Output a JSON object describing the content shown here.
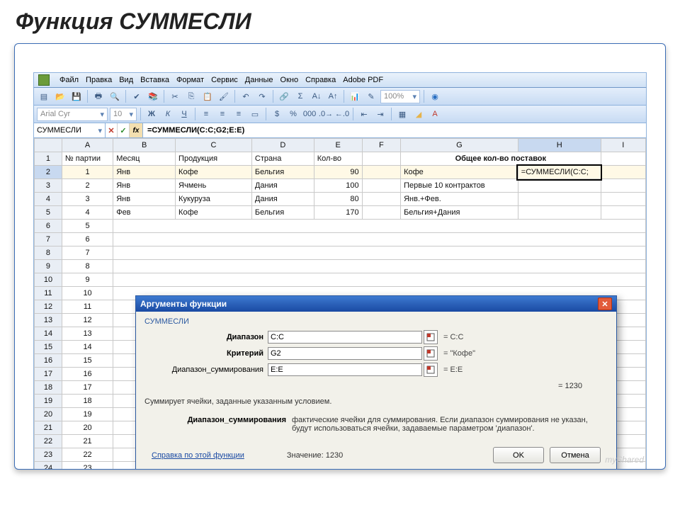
{
  "slide": {
    "title": "Функция СУММЕСЛИ"
  },
  "menu": {
    "file": "Файл",
    "edit": "Правка",
    "view": "Вид",
    "insert": "Вставка",
    "format": "Формат",
    "tools": "Сервис",
    "data": "Данные",
    "window": "Окно",
    "help": "Справка",
    "pdf": "Adobe PDF"
  },
  "toolbar": {
    "zoom": "100%"
  },
  "fontbar": {
    "font": "Arial Cyr",
    "size": "10",
    "bold": "Ж",
    "italic": "К",
    "underline": "Ч"
  },
  "editbar": {
    "name": "СУММЕСЛИ",
    "fx": "fx",
    "formula": "=СУММЕСЛИ(C:C;G2;E:E)"
  },
  "cols": [
    "",
    "A",
    "B",
    "C",
    "D",
    "E",
    "F",
    "G",
    "H",
    "I"
  ],
  "headers": {
    "a": "№ партии",
    "b": "Месяц",
    "c": "Продукция",
    "d": "Страна",
    "e": "Кол-во",
    "gh": "Общее кол-во поставок"
  },
  "rows": [
    {
      "n": "1"
    },
    {
      "n": "2",
      "a": "1",
      "b": "Янв",
      "c": "Кофе",
      "d": "Бельгия",
      "e": "90",
      "g": "Кофе",
      "h": "=СУММЕСЛИ(C:C;"
    },
    {
      "n": "3",
      "a": "2",
      "b": "Янв",
      "c": "Ячмень",
      "d": "Дания",
      "e": "100",
      "g": "Первые 10 контрактов"
    },
    {
      "n": "4",
      "a": "3",
      "b": "Янв",
      "c": "Кукуруза",
      "d": "Дания",
      "e": "80",
      "g": "Янв.+Фев."
    },
    {
      "n": "5",
      "a": "4",
      "b": "Фев",
      "c": "Кофе",
      "d": "Бельгия",
      "e": "170",
      "g": "Бельгия+Дания"
    },
    {
      "n": "6",
      "a": "5"
    },
    {
      "n": "7",
      "a": "6"
    },
    {
      "n": "8",
      "a": "7"
    },
    {
      "n": "9",
      "a": "8"
    },
    {
      "n": "10",
      "a": "9"
    },
    {
      "n": "11",
      "a": "10"
    },
    {
      "n": "12",
      "a": "11"
    },
    {
      "n": "13",
      "a": "12"
    },
    {
      "n": "14",
      "a": "13"
    },
    {
      "n": "15",
      "a": "14"
    },
    {
      "n": "16",
      "a": "15"
    },
    {
      "n": "17",
      "a": "16"
    },
    {
      "n": "18",
      "a": "17"
    },
    {
      "n": "19",
      "a": "18"
    },
    {
      "n": "20",
      "a": "19"
    },
    {
      "n": "21",
      "a": "20"
    },
    {
      "n": "22",
      "a": "21"
    },
    {
      "n": "23",
      "a": "22"
    },
    {
      "n": "24",
      "a": "23"
    }
  ],
  "dialog": {
    "title": "Аргументы функции",
    "fn": "СУММЕСЛИ",
    "args": {
      "range": {
        "label": "Диапазон",
        "value": "C:C",
        "eq": "= C:C"
      },
      "crit": {
        "label": "Критерий",
        "value": "G2",
        "eq": "= \"Кофе\""
      },
      "sum": {
        "label": "Диапазон_суммирования",
        "value": "E:E",
        "eq": "= E:E"
      }
    },
    "result_eq": "= 1230",
    "desc": "Суммирует ячейки, заданные указанным условием.",
    "arg_help_label": "Диапазон_суммирования",
    "arg_help_text": "фактические ячейки для суммирования. Если диапазон суммирования не указан, будут использоваться ячейки, задаваемые параметром 'диапазон'.",
    "help_link": "Справка по этой функции",
    "value_label": "Значение:",
    "value": "1230",
    "ok": "OK",
    "cancel": "Отмена"
  },
  "watermark": "myShared"
}
